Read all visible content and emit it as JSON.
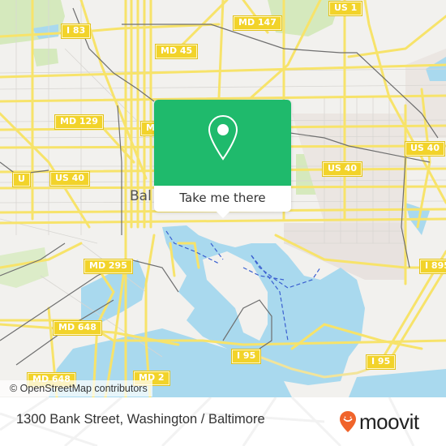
{
  "map": {
    "city_label": "Baltimore",
    "city_label_visible": "Bal",
    "attribution": "© OpenStreetMap contributors",
    "road_shields": [
      {
        "id": "us1",
        "label": "US 1"
      },
      {
        "id": "md147",
        "label": "MD 147"
      },
      {
        "id": "i83",
        "label": "I 83"
      },
      {
        "id": "md45",
        "label": "MD 45"
      },
      {
        "id": "md129",
        "label": "MD 129"
      },
      {
        "id": "md-partial",
        "label": "MD"
      },
      {
        "id": "us40-left-partial",
        "label": "U"
      },
      {
        "id": "us40-left",
        "label": "US 40"
      },
      {
        "id": "us40-right",
        "label": "US 40"
      },
      {
        "id": "us40-far-right",
        "label": "US 40"
      },
      {
        "id": "md295",
        "label": "MD 295"
      },
      {
        "id": "md648-upper",
        "label": "MD 648"
      },
      {
        "id": "md648-lower",
        "label": "MD 648"
      },
      {
        "id": "md2",
        "label": "MD 2"
      },
      {
        "id": "i95-left",
        "label": "I 95"
      },
      {
        "id": "i95-right",
        "label": "I 95"
      },
      {
        "id": "i895",
        "label": "I 895"
      }
    ],
    "colors": {
      "land": "#f2f1ee",
      "water": "#a9d9ee",
      "park": "#cde8b0",
      "road": "#f7e36a",
      "shield": "#f2d32a",
      "rail": "#6f6f6f",
      "ferry": "#3a5fd0"
    }
  },
  "popup": {
    "icon": "map-pin-icon",
    "cta_label": "Take me there",
    "color": "#1fba6c"
  },
  "footer": {
    "address": "1300 Bank Street, Washington / Baltimore",
    "logo_icon": "moovit-smile-pin-icon",
    "logo_text": "moovit",
    "logo_color": "#f0642b"
  }
}
